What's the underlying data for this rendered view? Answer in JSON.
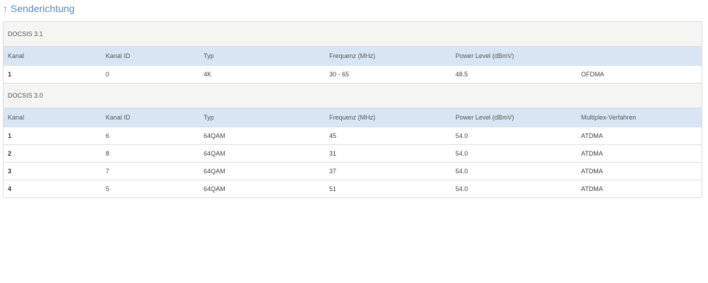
{
  "title": "↑ Senderichtung",
  "columns": [
    "Kanal",
    "Kanal ID",
    "Typ",
    "Frequenz (MHz)",
    "Power Level (dBmV)",
    "Multiplex-Verfahren"
  ],
  "groups": [
    {
      "name": "DOCSIS 3.1",
      "columns": [
        "Kanal",
        "Kanal ID",
        "Typ",
        "Frequenz (MHz)",
        "Power Level (dBmV)",
        ""
      ],
      "rows": [
        [
          "1",
          "0",
          "4K",
          "30 - 65",
          "48.5",
          "OFDMA"
        ]
      ]
    },
    {
      "name": "DOCSIS 3.0",
      "columns": [
        "Kanal",
        "Kanal ID",
        "Typ",
        "Frequenz (MHz)",
        "Power Level (dBmV)",
        "Multiplex-Verfahren"
      ],
      "rows": [
        [
          "1",
          "6",
          "64QAM",
          "45",
          "54.0",
          "ATDMA"
        ],
        [
          "2",
          "8",
          "64QAM",
          "31",
          "54.0",
          "ATDMA"
        ],
        [
          "3",
          "7",
          "64QAM",
          "37",
          "54.0",
          "ATDMA"
        ],
        [
          "4",
          "5",
          "64QAM",
          "51",
          "54.0",
          "ATDMA"
        ]
      ]
    }
  ]
}
